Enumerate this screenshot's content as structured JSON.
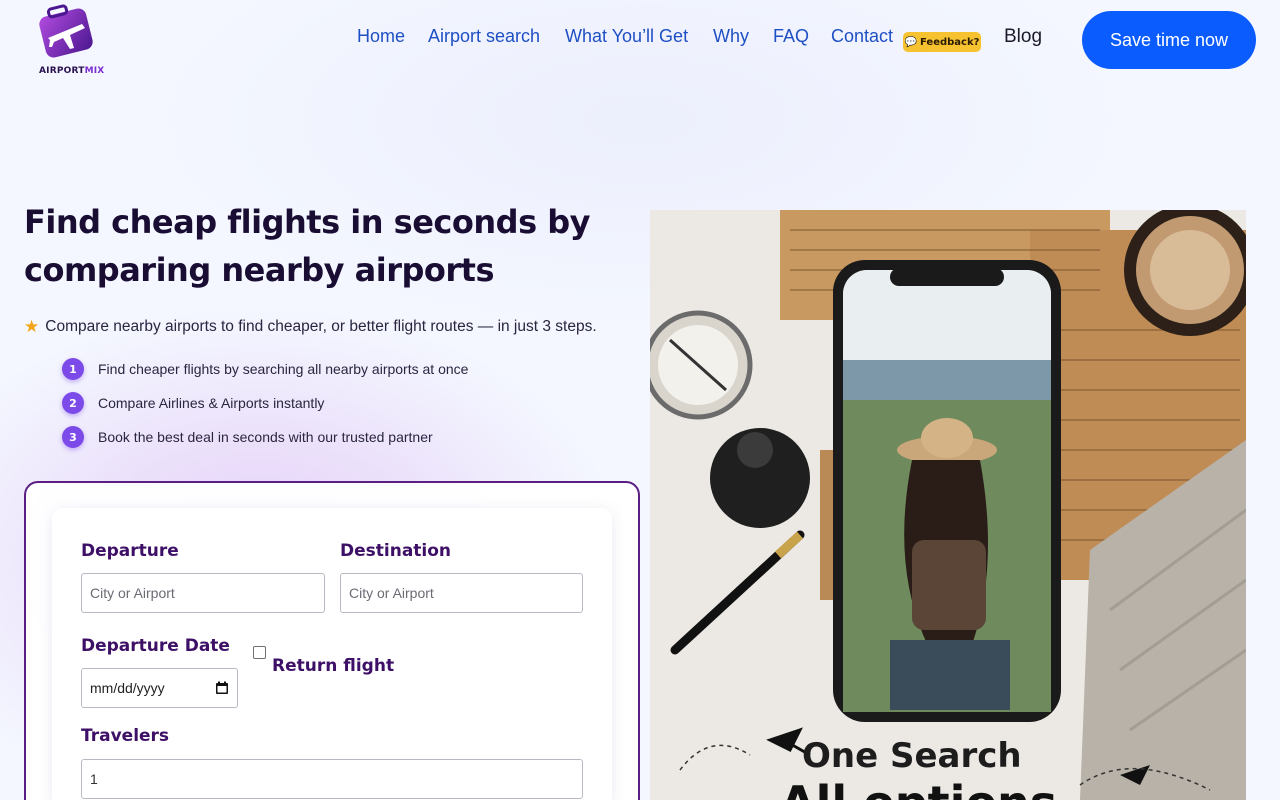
{
  "header": {
    "logo_text": "AIRPORT",
    "logo_text_accent": "MIX",
    "nav": [
      {
        "label": "Home"
      },
      {
        "label": "Airport search"
      },
      {
        "label": "What You’ll Get"
      },
      {
        "label": "Why"
      },
      {
        "label": "FAQ"
      },
      {
        "label": "Contact"
      }
    ],
    "feedback_badge": "Feedback?",
    "feedback_icon": "chat-bubble-icon",
    "blog": "Blog",
    "cta": "Save time now",
    "brand_color": "#0b5cff"
  },
  "hero": {
    "title": "Find cheap flights in seconds by comparing nearby airports",
    "tagline": "Compare nearby airports to find cheaper, or better flight routes — in just 3 steps.",
    "tagline_icon": "star-icon",
    "steps": [
      {
        "num": "1",
        "text": "Find cheaper flights by searching all nearby airports at once"
      },
      {
        "num": "2",
        "text": "Compare Airlines & Airports instantly"
      },
      {
        "num": "3",
        "text": "Book the best deal in seconds with our trusted partner"
      }
    ]
  },
  "form": {
    "departure_label": "Departure",
    "departure_placeholder": "City or Airport",
    "destination_label": "Destination",
    "destination_placeholder": "City or Airport",
    "date_label": "Departure Date",
    "date_placeholder": "mm/dd/yyyy",
    "return_label": "Return flight",
    "return_checked": false,
    "travelers_label": "Travelers",
    "travelers_value": "1",
    "accent_color": "#3d0f66"
  },
  "promo": {
    "line1": "One Search",
    "line2": "All options"
  }
}
